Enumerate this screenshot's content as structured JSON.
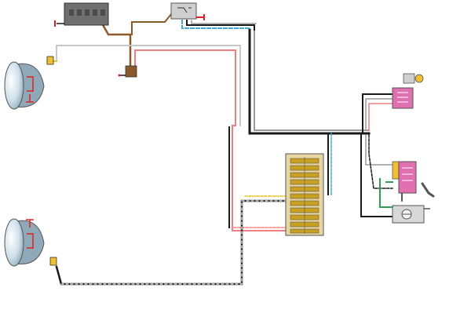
{
  "diagram": {
    "background": "#ffffff",
    "wire_colors": {
      "black": "#1a1a1a",
      "grey": "#9a9a9a",
      "light_grey": "#c8c8c8",
      "pink": "#f08080",
      "brown": "#8b5a2b",
      "blue": "#3fa9d6",
      "green": "#2e9e4f",
      "yellow": "#e8c020",
      "white_dash": "#ffffff"
    },
    "component_colors": {
      "headlamp_body": "#8fa9b8",
      "headlamp_lens": "#dce8f0",
      "battery": "#777777",
      "fusebox": "#e8d6a0",
      "fuse": "#c9a020",
      "connector_pink": "#e070b0",
      "connector_yellow": "#f0c030",
      "ground_red": "#e02020",
      "relay_grey": "#cfcfcf",
      "switch_body": "#d8d8d8"
    },
    "components": [
      {
        "id": "battery",
        "type": "battery"
      },
      {
        "id": "relay-box",
        "type": "relay"
      },
      {
        "id": "headlamp-left",
        "type": "headlamp"
      },
      {
        "id": "headlamp-right",
        "type": "headlamp"
      },
      {
        "id": "fuse-box",
        "type": "fusebox",
        "fuse_count": 11
      },
      {
        "id": "connector-right-top",
        "type": "connector"
      },
      {
        "id": "bulb-top-right",
        "type": "bulb"
      },
      {
        "id": "connector-right-mid",
        "type": "connector"
      },
      {
        "id": "switch-right",
        "type": "switch"
      },
      {
        "id": "stalk-lever",
        "type": "lever"
      }
    ]
  }
}
